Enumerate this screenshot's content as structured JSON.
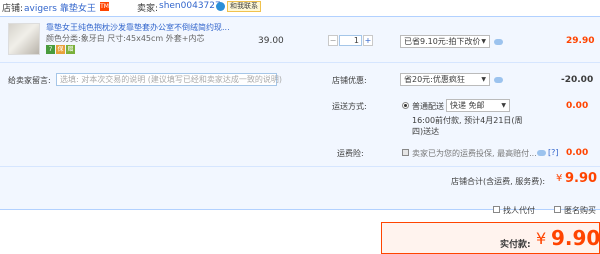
{
  "shop": {
    "label": "店铺:",
    "name": "avigers 靠垫女王",
    "badge": "TM",
    "seller_label": "卖家:",
    "seller_id": "shen0043727",
    "contact": "和我联系"
  },
  "item": {
    "title": "靠垫女王纯色抱枕沙发靠垫套办公室不倒绒简约现...",
    "sku": "颜色分类:象牙白  尺寸:45x45cm 外套+内芯",
    "services": [
      "7",
      "保",
      "赠"
    ],
    "price": "39.00",
    "qty_minus": "−",
    "quantity": "1",
    "qty_plus": "+",
    "discount_option": "已省9.10元:拍下改价",
    "subtotal": "29.90"
  },
  "memo": {
    "label": "给卖家留言:",
    "placeholder": "选填: 对本次交易的说明 (建议填写已经和卖家达成一致的说明)"
  },
  "shop_promo": {
    "label": "店铺优惠:",
    "option": "省20元:优惠疯狂",
    "amount": "-20.00"
  },
  "shipping": {
    "label": "运送方式:",
    "method": "普通配送",
    "option": "快递 免邮",
    "note_line1": "16:00前付款, 预计4月21日(周",
    "note_line2": "四)送达",
    "amount": "0.00"
  },
  "insurance": {
    "label": "运费险:",
    "text": "卖家已为您的运费投保, 最高赔付...",
    "help": "[?]",
    "amount": "0.00"
  },
  "shop_total": {
    "label": "店铺合计(含运费, 服务费):",
    "currency": "¥",
    "value": "9.90"
  },
  "options": {
    "proxy_pay": "找人代付",
    "anonymous": "匿名购买"
  },
  "pay": {
    "label": "实付款:",
    "currency": "¥",
    "value": "9.90"
  },
  "colors": {
    "accent": "#ff4400",
    "link": "#3366cc",
    "panel_bg": "#f2f7ff",
    "panel_border": "#b2d1ff"
  }
}
